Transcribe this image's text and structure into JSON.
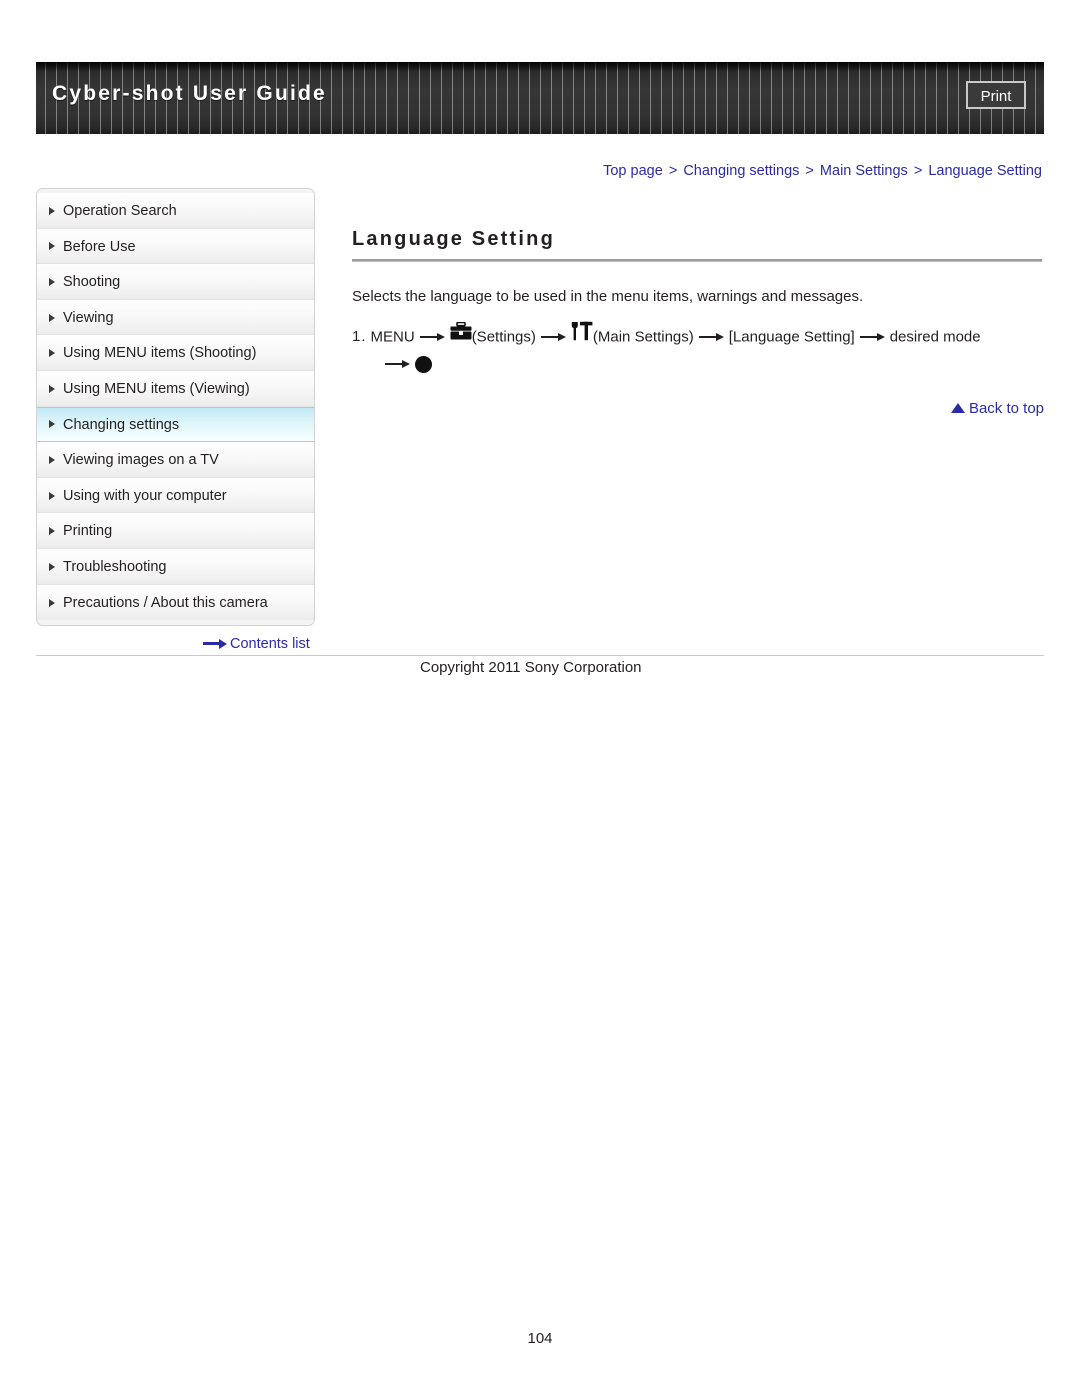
{
  "header": {
    "title": "Cyber-shot User Guide",
    "print_label": "Print"
  },
  "breadcrumb": {
    "items": [
      "Top page",
      "Changing settings",
      "Main Settings",
      "Language Setting"
    ],
    "separator": ">"
  },
  "sidebar": {
    "items": [
      {
        "label": "Operation Search",
        "active": false
      },
      {
        "label": "Before Use",
        "active": false
      },
      {
        "label": "Shooting",
        "active": false
      },
      {
        "label": "Viewing",
        "active": false
      },
      {
        "label": "Using MENU items (Shooting)",
        "active": false
      },
      {
        "label": "Using MENU items (Viewing)",
        "active": false
      },
      {
        "label": "Changing settings",
        "active": true
      },
      {
        "label": "Viewing images on a TV",
        "active": false
      },
      {
        "label": "Using with your computer",
        "active": false
      },
      {
        "label": "Printing",
        "active": false
      },
      {
        "label": "Troubleshooting",
        "active": false
      },
      {
        "label": "Precautions / About this camera",
        "active": false
      }
    ],
    "contents_link": "Contents list"
  },
  "main": {
    "title": "Language Setting",
    "intro": "Selects the language to be used in the menu items, warnings and messages.",
    "step": {
      "number": "1.",
      "menu_label": "MENU",
      "settings_label": "(Settings)",
      "main_settings_label": "(Main Settings)",
      "bracket_label": "[Language Setting]",
      "desired_label": "desired mode"
    },
    "back_to_top": "Back to top"
  },
  "footer": {
    "copyright": "Copyright 2011 Sony Corporation",
    "page_number": "104"
  },
  "colors": {
    "link_blue": "#2b2ba8",
    "header_dark": "#2e2e2e",
    "active_highlight": "#bfe9f5",
    "text": "#231f20"
  }
}
